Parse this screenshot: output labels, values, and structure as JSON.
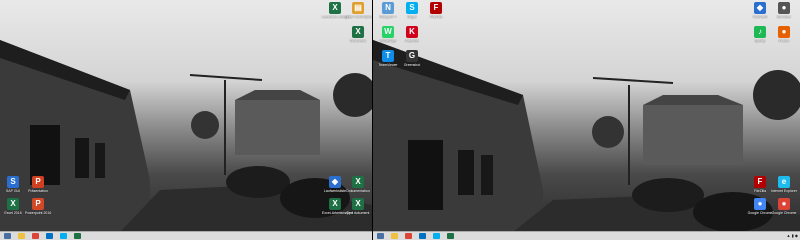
{
  "monitor1": {
    "icons_right": [
      {
        "name": "excel-icon",
        "label": "Leerstelle anlegen",
        "color": "#1e7145",
        "glyph": "X"
      },
      {
        "name": "folder-icon",
        "label": "Teilen Verknüpfung",
        "color": "#e0a030",
        "glyph": "▤"
      },
      {
        "name": "excel-icon-2",
        "label": "Dokument",
        "color": "#1e7145",
        "glyph": "X"
      }
    ],
    "icons_left": [
      {
        "name": "app-icon-blue",
        "label": "SAP GUI",
        "color": "#2a6fd0",
        "glyph": "S"
      },
      {
        "name": "app-icon-red",
        "label": "Präsentation",
        "color": "#d04020",
        "glyph": "P"
      },
      {
        "name": "excel-2016-icon",
        "label": "Excel 2016",
        "color": "#1e7145",
        "glyph": "X"
      },
      {
        "name": "powerpoint-icon",
        "label": "Powerpoint 2016",
        "color": "#d24726",
        "glyph": "P"
      }
    ],
    "icons_bottom": [
      {
        "name": "drive-icon",
        "label": "Laufwerksliste",
        "color": "#2a6fd0",
        "glyph": "◆"
      },
      {
        "name": "word-icon",
        "label": "Dokumentation",
        "color": "#1e7145",
        "glyph": "X"
      },
      {
        "name": "excel-doc-icon",
        "label": "Excel-Arbeitsmappe",
        "color": "#1e7145",
        "glyph": "X"
      },
      {
        "name": "text-doc-icon",
        "label": "Text dokument",
        "color": "#1e7145",
        "glyph": "X"
      }
    ]
  },
  "monitor2": {
    "icons_top": [
      {
        "name": "notepad-icon",
        "label": "Notepad++",
        "color": "#5b9bd5",
        "glyph": "N"
      },
      {
        "name": "skype-icon",
        "label": "Skype",
        "color": "#00aff0",
        "glyph": "S"
      },
      {
        "name": "filezilla-icon",
        "label": "FileZilla",
        "color": "#b40000",
        "glyph": "F"
      },
      {
        "name": "whatsapp-icon",
        "label": "WhatsApp",
        "color": "#25d366",
        "glyph": "W"
      },
      {
        "name": "kalender-icon",
        "label": "Kalender",
        "color": "#d0021b",
        "glyph": "K"
      },
      {
        "name": "teamviewer-icon",
        "label": "TeamViewer",
        "color": "#0e8ee9",
        "glyph": "T"
      },
      {
        "name": "greenshot-icon",
        "label": "Greenshot",
        "color": "#333333",
        "glyph": "G"
      }
    ],
    "icons_right": [
      {
        "name": "network-icon",
        "label": "Netzwerk",
        "color": "#2a6fd0",
        "glyph": "◆"
      },
      {
        "name": "user-icon",
        "label": "Benutzer",
        "color": "#555555",
        "glyph": "●"
      },
      {
        "name": "spotify-icon",
        "label": "Spotify",
        "color": "#1db954",
        "glyph": "♪"
      },
      {
        "name": "firefox-icon",
        "label": "Firefox",
        "color": "#e66000",
        "glyph": "●"
      },
      {
        "name": "filezilla-icon-2",
        "label": "FileZilla",
        "color": "#b40000",
        "glyph": "F"
      },
      {
        "name": "ie-icon",
        "label": "Internet Explorer",
        "color": "#1ebbee",
        "glyph": "e"
      },
      {
        "name": "chrome-icon",
        "label": "Google Chrome",
        "color": "#4285f4",
        "glyph": "●"
      },
      {
        "name": "chrome-icon-2",
        "label": "Google Chrome",
        "color": "#db4437",
        "glyph": "●"
      }
    ]
  },
  "taskbar": {
    "buttons": [
      {
        "name": "start-button",
        "color": "#4a6fa5"
      },
      {
        "name": "explorer-taskbar-icon",
        "color": "#f0c040"
      },
      {
        "name": "chrome-taskbar-icon",
        "color": "#db4437"
      },
      {
        "name": "outlook-taskbar-icon",
        "color": "#0072c6"
      },
      {
        "name": "skype-taskbar-icon",
        "color": "#00aff0"
      },
      {
        "name": "excel-taskbar-icon",
        "color": "#1e7145"
      }
    ]
  }
}
